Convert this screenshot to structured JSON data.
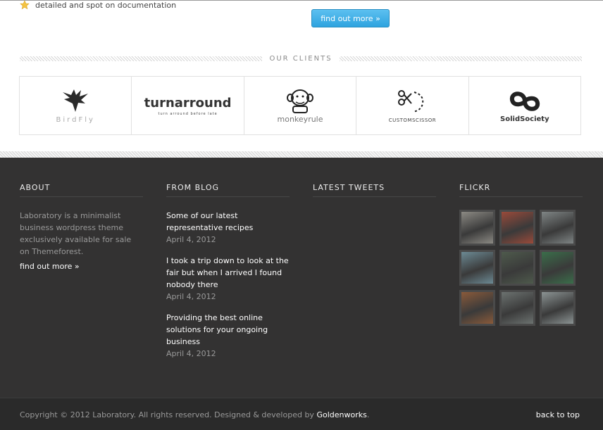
{
  "features": {
    "doc_text": "detailed and spot on documentation",
    "find_out_more": "find out more »"
  },
  "clients": {
    "title": "OUR CLIENTS",
    "items": [
      {
        "name": "BirdFly",
        "icon": "bird-icon"
      },
      {
        "name": "turnarround",
        "tagline": "turn arround before late",
        "icon": "turnarround-logo"
      },
      {
        "name": "monkeyrule",
        "icon": "monkey-icon"
      },
      {
        "name": "CUSTOMSCISSOR",
        "icon": "scissor-icon"
      },
      {
        "name": "SolidSociety",
        "icon": "solid-society-icon"
      }
    ]
  },
  "footer": {
    "about": {
      "title": "ABOUT",
      "text": "Laboratory is a minimalist business wordpress theme exclusively available for sale on Themeforest.",
      "link": "find out more »"
    },
    "blog": {
      "title": "FROM BLOG",
      "posts": [
        {
          "title": "Some of our latest representative recipes",
          "date": "April 4, 2012"
        },
        {
          "title": "I took a trip down to look at the fair but when I arrived I found nobody there",
          "date": "April 4, 2012"
        },
        {
          "title": "Providing the best online solutions for your ongoing business",
          "date": "April 4, 2012"
        }
      ]
    },
    "tweets": {
      "title": "LATEST TWEETS"
    },
    "flickr": {
      "title": "FLICKR",
      "photos": [
        {
          "icon": "photo-people-desk",
          "color": "#8c8a84"
        },
        {
          "icon": "photo-hallway-red",
          "color": "#9a4a3a"
        },
        {
          "icon": "photo-office-room",
          "color": "#7f8585"
        },
        {
          "icon": "photo-two-men",
          "color": "#6c8a94"
        },
        {
          "icon": "photo-presentation",
          "color": "#4e5a4c"
        },
        {
          "icon": "photo-group-green",
          "color": "#3a6e4a"
        },
        {
          "icon": "photo-brick-room",
          "color": "#8a5a3a"
        },
        {
          "icon": "photo-workspace",
          "color": "#6c7270"
        },
        {
          "icon": "photo-corridor",
          "color": "#8c9494"
        }
      ]
    }
  },
  "copyright": {
    "text": "Copyright © 2012 Laboratory. All rights reserved. Designed & developed by ",
    "author": "Goldenworks",
    "period": ".",
    "back_to_top": "back to top"
  }
}
